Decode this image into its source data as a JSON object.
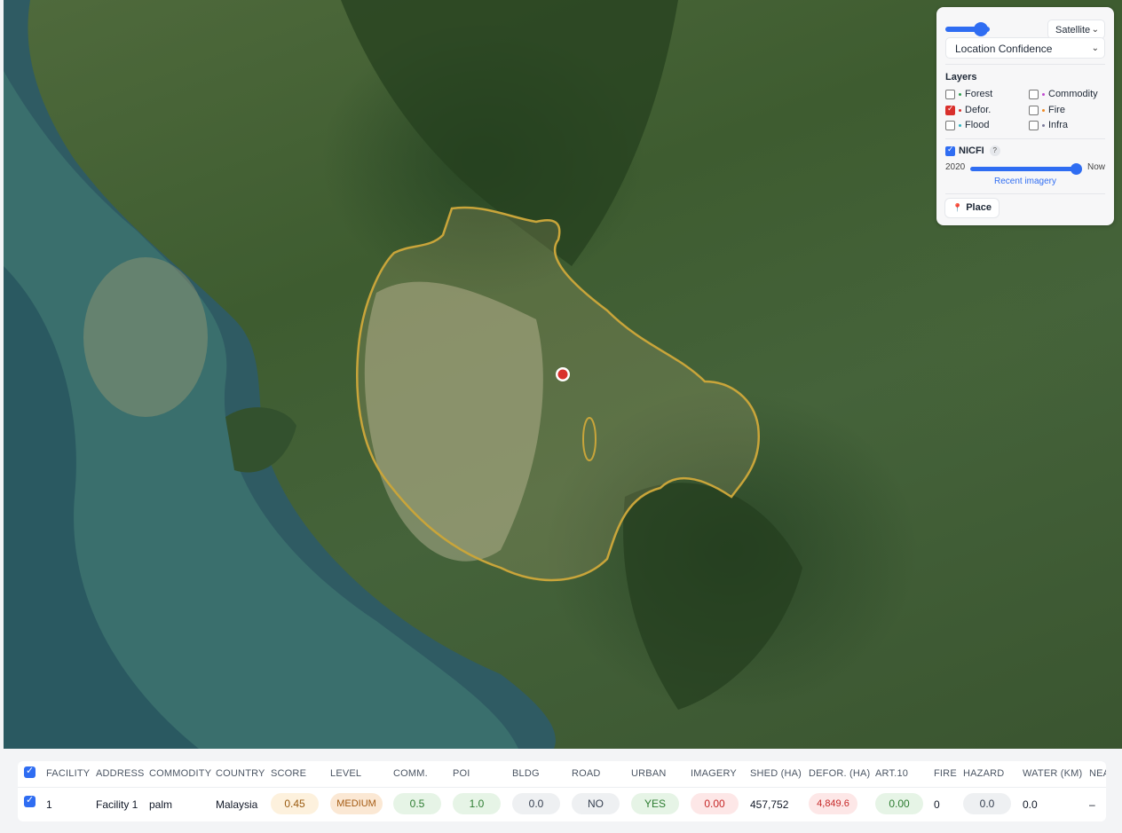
{
  "map": {
    "basemap": "Satellite",
    "overlay_mode": "Location Confidence"
  },
  "panel": {
    "layers_title": "Layers",
    "layers": [
      {
        "label": "Forest",
        "checked": false,
        "color": "#2e9e4f"
      },
      {
        "label": "Commodity",
        "checked": false,
        "color": "#c04ad0"
      },
      {
        "label": "Defor.",
        "checked": true,
        "color": "#d9302c"
      },
      {
        "label": "Fire",
        "checked": false,
        "color": "#f08a24"
      },
      {
        "label": "Flood",
        "checked": false,
        "color": "#2bb3c0"
      },
      {
        "label": "Infra",
        "checked": false,
        "color": "#7a7a9a"
      }
    ],
    "nicfi_label": "NICFI",
    "nicfi_checked": true,
    "help_glyph": "?",
    "year_start": "2020",
    "year_end": "Now",
    "recent_imagery": "Recent imagery",
    "place_label": "Place"
  },
  "table": {
    "headers": [
      "FACILITY",
      "ADDRESS",
      "COMMODITY",
      "COUNTRY",
      "SCORE",
      "LEVEL",
      "COMM.",
      "POI",
      "BLDG",
      "ROAD",
      "URBAN",
      "IMAGERY",
      "SHED (HA)",
      "DEFOR. (HA)",
      "ART.10",
      "FIRE",
      "HAZARD",
      "WATER (KM)",
      "NEA"
    ],
    "row": {
      "facility": "1",
      "address": "Facility 1",
      "commodity": "palm",
      "country": "Malaysia",
      "score": "0.45",
      "level": "MEDIUM",
      "comm": "0.5",
      "poi": "1.0",
      "bldg": "0.0",
      "road": "NO",
      "urban": "YES",
      "imagery": "0.00",
      "shed": "457,752",
      "defor": "4,849.6",
      "art10": "0.00",
      "fire": "0",
      "hazard": "0.0",
      "water": "0.0",
      "nea": "–"
    }
  },
  "colors": {
    "accent": "#2f6df2",
    "marker": "#d9302c",
    "boundary": "#c9a53a"
  }
}
